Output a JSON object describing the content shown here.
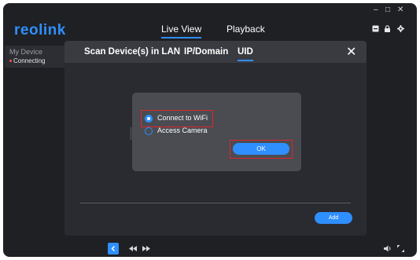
{
  "app": {
    "logo": "reolink",
    "window_controls": [
      "–",
      "□",
      "✕"
    ]
  },
  "nav": {
    "tabs": [
      {
        "label": "Live View",
        "active": true
      },
      {
        "label": "Playback",
        "active": false
      }
    ],
    "header_icons": [
      "download-icon",
      "lock-icon",
      "gear-icon"
    ]
  },
  "sidebar": {
    "title": "My Device",
    "status": "Connecting"
  },
  "dialog": {
    "tabs": [
      {
        "label": "Scan Device(s) in LAN",
        "active": false
      },
      {
        "label": "IP/Domain",
        "active": false
      },
      {
        "label": "UID",
        "active": true
      }
    ],
    "close": "✕",
    "add_label": "Add"
  },
  "popup": {
    "options": [
      {
        "label": "Connect to WiFi",
        "selected": true
      },
      {
        "label": "Access Camera",
        "selected": false
      }
    ],
    "ok_label": "OK"
  },
  "bottom_controls": [
    "chevron-left-icon",
    "rewind-icon",
    "fast-forward-icon",
    "volume-icon",
    "fullscreen-icon"
  ],
  "colors": {
    "accent": "#2f8fff",
    "highlight": "#e0262a",
    "background": "#1f2023",
    "dialog": "#2a2b30",
    "popup": "#4a4c51"
  }
}
